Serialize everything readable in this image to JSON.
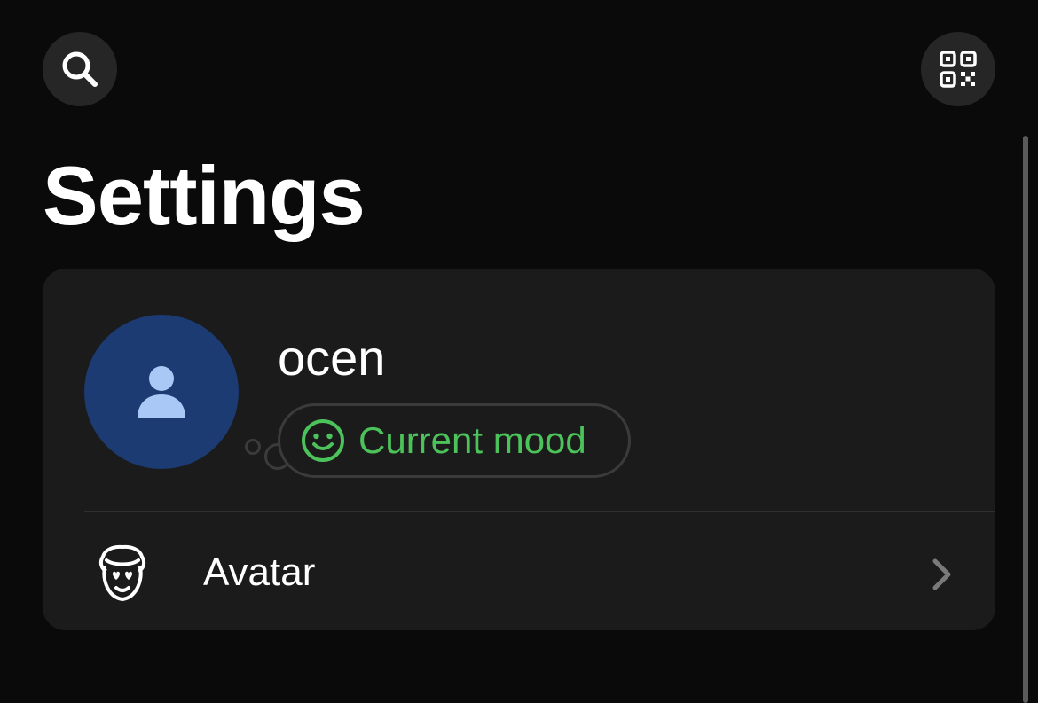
{
  "header": {
    "search_icon": "search-icon",
    "qr_icon": "qr-code-icon",
    "title": "Settings"
  },
  "profile": {
    "avatar_icon": "person-icon",
    "username": "ocen",
    "mood": {
      "icon": "smiley-face-icon",
      "label": "Current mood",
      "color": "#4cc25a"
    },
    "avatar_color": "#1b3b72"
  },
  "menu": {
    "items": [
      {
        "icon": "memoji-face-icon",
        "label": "Avatar",
        "chevron": "chevron-right-icon"
      }
    ]
  }
}
